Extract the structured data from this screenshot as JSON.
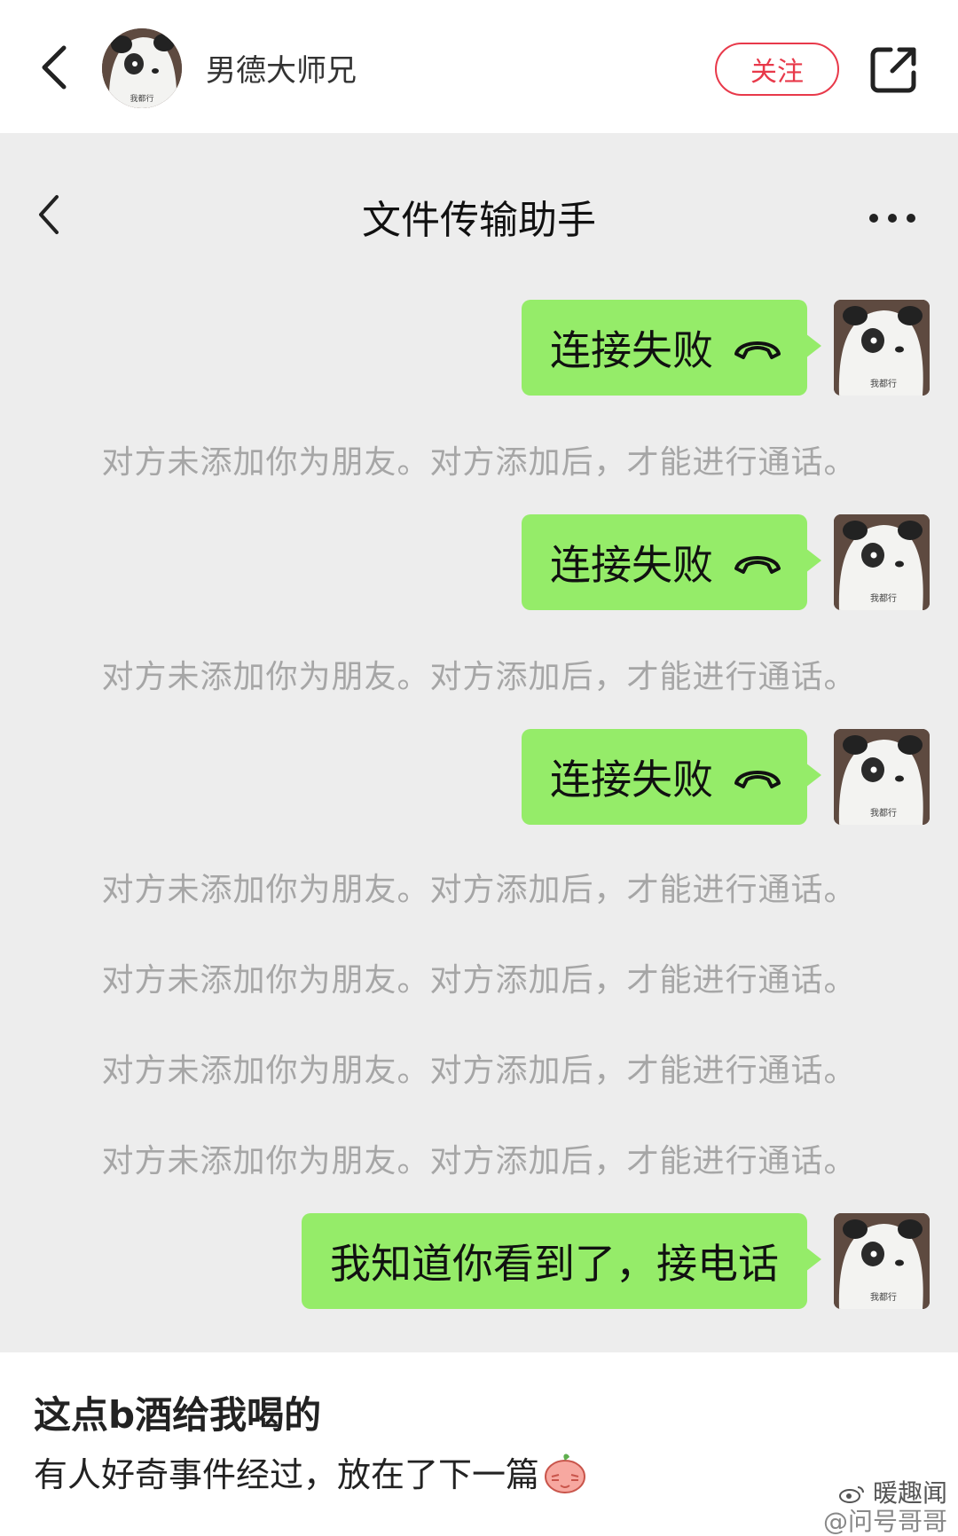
{
  "header": {
    "username": "男德大师兄",
    "avatar_caption": "我都行",
    "follow_label": "关注"
  },
  "chat": {
    "title": "文件传输助手",
    "messages": [
      {
        "type": "call",
        "text": "连接失败"
      },
      {
        "type": "system",
        "text": "对方未添加你为朋友。对方添加后，才能进行通话。"
      },
      {
        "type": "call",
        "text": "连接失败"
      },
      {
        "type": "system",
        "text": "对方未添加你为朋友。对方添加后，才能进行通话。"
      },
      {
        "type": "call",
        "text": "连接失败"
      },
      {
        "type": "system",
        "text": "对方未添加你为朋友。对方添加后，才能进行通话。"
      },
      {
        "type": "system",
        "text": "对方未添加你为朋友。对方添加后，才能进行通话。"
      },
      {
        "type": "system",
        "text": "对方未添加你为朋友。对方添加后，才能进行通话。"
      },
      {
        "type": "system",
        "text": "对方未添加你为朋友。对方添加后，才能进行通话。"
      },
      {
        "type": "text",
        "text": "我知道你看到了，接电话"
      }
    ]
  },
  "post": {
    "title": "这点b酒给我喝的",
    "body": "有人好奇事件经过，放在了下一篇"
  },
  "watermark": {
    "line1": "暖趣闻",
    "line2": "@问号哥哥"
  },
  "colors": {
    "bubble": "#95ec69",
    "chat_bg": "#ededed",
    "follow": "#e8394a",
    "system_text": "#a6a6a6"
  },
  "icons": [
    "chevron-left-icon",
    "share-icon",
    "more-icon",
    "phone-hangup-icon",
    "weibo-icon",
    "peach-emoji-icon"
  ]
}
